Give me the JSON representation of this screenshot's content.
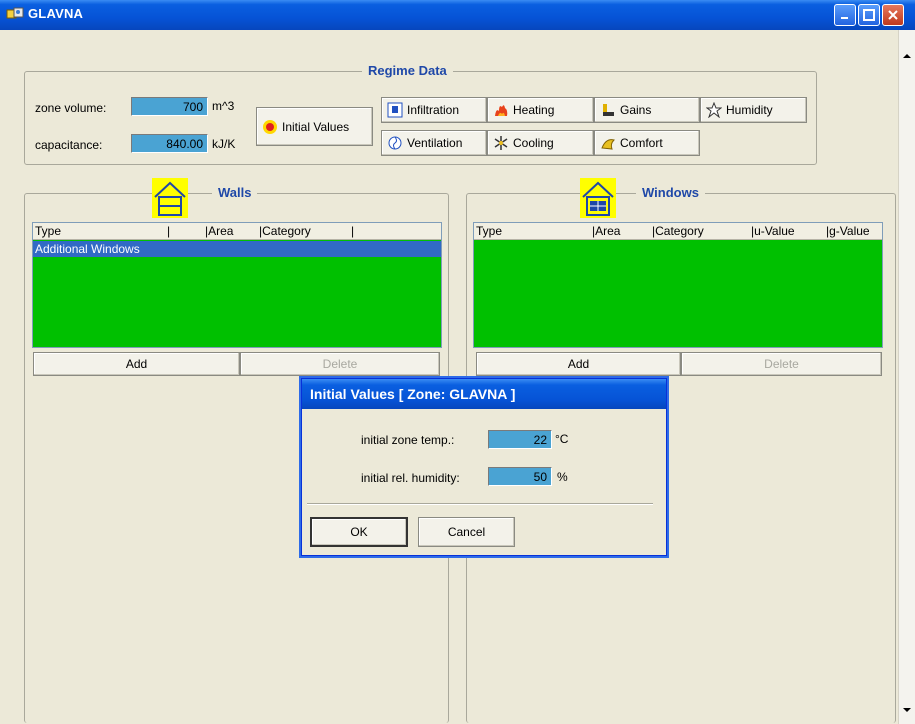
{
  "window": {
    "title": "GLAVNA"
  },
  "regime": {
    "title": "Regime Data",
    "zone_volume_label": "zone volume:",
    "zone_volume_value": "700",
    "zone_volume_unit": "m^3",
    "capacitance_label": "capacitance:",
    "capacitance_value": "840.00",
    "capacitance_unit": "kJ/K",
    "initial_values_button": "Initial Values",
    "buttons": {
      "infiltration": "Infiltration",
      "heating": "Heating",
      "gains": "Gains",
      "humidity": "Humidity",
      "ventilation": "Ventilation",
      "cooling": "Cooling",
      "comfort": "Comfort"
    }
  },
  "walls": {
    "title": "Walls",
    "columns": [
      "Type",
      "|Area",
      "|Category",
      "|"
    ],
    "rows": [
      "Additional Windows"
    ],
    "add_label": "Add",
    "delete_label": "Delete"
  },
  "windows": {
    "title": "Windows",
    "columns": [
      "Type",
      "|Area",
      "|Category",
      "|u-Value",
      "|g-Value"
    ],
    "rows": [],
    "add_label": "Add",
    "delete_label": "Delete"
  },
  "dialog": {
    "title": "Initial Values [ Zone: GLAVNA ]",
    "zone_temp_label": "initial zone temp.:",
    "zone_temp_value": "22",
    "zone_temp_unit": "°C",
    "humidity_label": "initial rel. humidity:",
    "humidity_value": "50",
    "humidity_unit": "%",
    "ok_label": "OK",
    "cancel_label": "Cancel"
  },
  "colors": {
    "title_bar": "#0653d6",
    "field_bg": "#4aa3d3",
    "list_bg": "#00c000",
    "selection": "#316ac5",
    "group_title": "#1f48a8"
  }
}
